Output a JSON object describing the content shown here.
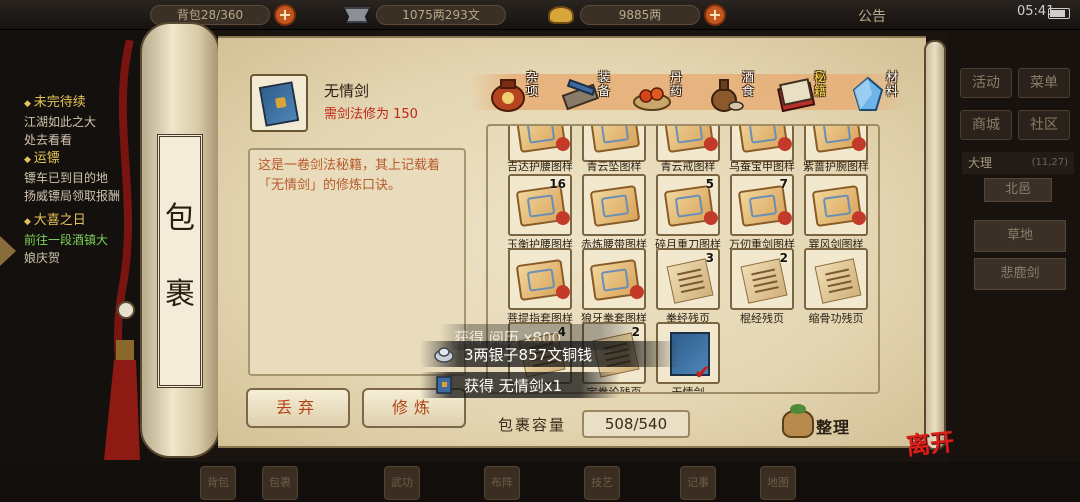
{
  "topbar": {
    "bag_capacity": "背包28/360",
    "copper": "1075两293文",
    "silver": "9885两",
    "notice": "公告",
    "time": "05:41"
  },
  "quests": [
    {
      "title": "未完待续",
      "lines": [
        "江湖如此之大",
        "处去看看"
      ]
    },
    {
      "title": "运镖",
      "lines": [
        "镖车已到目的地",
        "扬威镖局领取报酬"
      ]
    },
    {
      "title": "大喜之日",
      "lines": [
        "前往一段酒镇大",
        "娘庆贺"
      ]
    }
  ],
  "right_menu": {
    "activity": "活动",
    "menu": "菜单",
    "shop": "商城",
    "community": "社区",
    "location": "大理",
    "coords": "(11,27)",
    "node1": "北邑",
    "node2": "草地",
    "node3": "悲鹿剑"
  },
  "bottom_nav": [
    "背包",
    "包裹",
    "武功",
    "布阵",
    "技艺",
    "记事",
    "地图"
  ],
  "panel": {
    "title_char1": "包",
    "title_char2": "裹",
    "item_name": "无情剑",
    "item_req": "需剑法修为 150",
    "description": "这是一卷剑法秘籍，其上记载着「无情剑」的修炼口诀。",
    "drop_btn": "丢弃",
    "train_btn": "修炼",
    "capacity_label": "包裹容量",
    "capacity_value": "508/540",
    "sort_btn": "整理",
    "leave_btn": "离开"
  },
  "tabs": [
    {
      "label": "杂项",
      "active": false,
      "icon": "jar-icon"
    },
    {
      "label": "装备",
      "active": false,
      "icon": "equipment-icon"
    },
    {
      "label": "丹药",
      "active": false,
      "icon": "pill-icon"
    },
    {
      "label": "酒食",
      "active": false,
      "icon": "wine-icon"
    },
    {
      "label": "秘籍",
      "active": true,
      "icon": "manual-icon"
    },
    {
      "label": "材料",
      "active": false,
      "icon": "crystal-icon"
    }
  ],
  "items": [
    {
      "name": "吉达护腰图样",
      "count": "",
      "kind": "scroll"
    },
    {
      "name": "青云坠图样",
      "count": "",
      "kind": "scroll"
    },
    {
      "name": "青云戒图样",
      "count": "",
      "kind": "scroll"
    },
    {
      "name": "乌蚕宝甲图样",
      "count": "",
      "kind": "scroll"
    },
    {
      "name": "紫蔷护腕图样",
      "count": "",
      "kind": "scroll"
    },
    {
      "name": "玉衡护腰图样",
      "count": "16",
      "kind": "scroll"
    },
    {
      "name": "赤炼腰带图样",
      "count": "",
      "kind": "scroll"
    },
    {
      "name": "碎月重刀图样",
      "count": "5",
      "kind": "scroll"
    },
    {
      "name": "万仞重剑图样",
      "count": "7",
      "kind": "scroll"
    },
    {
      "name": "巽风剑图样",
      "count": "",
      "kind": "scroll"
    },
    {
      "name": "菩提指套图样",
      "count": "",
      "kind": "scroll"
    },
    {
      "name": "狼牙拳套图样",
      "count": "",
      "kind": "scroll"
    },
    {
      "name": "拳经残页",
      "count": "3",
      "kind": "page"
    },
    {
      "name": "棍经残页",
      "count": "2",
      "kind": "page"
    },
    {
      "name": "缩骨功残页",
      "count": "",
      "kind": "page"
    },
    {
      "name": "",
      "count": "4",
      "kind": "page"
    },
    {
      "name": "定拳论残页",
      "count": "2",
      "kind": "page"
    },
    {
      "name": "无情剑",
      "count": "",
      "kind": "book"
    }
  ],
  "toasts": {
    "faded": "获得 阅历 x800",
    "silver": "3两银子857文铜钱",
    "item": "获得 无情剑x1"
  }
}
